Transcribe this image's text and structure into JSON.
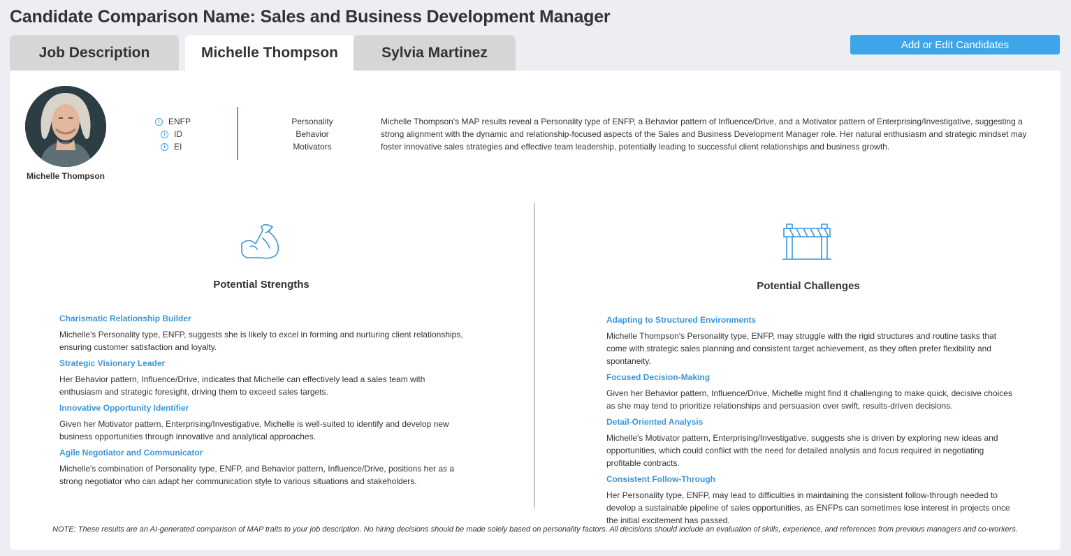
{
  "page": {
    "title": "Candidate Comparison Name: Sales and Business Development Manager"
  },
  "tabs": [
    {
      "label": "Job Description",
      "active": false
    },
    {
      "label": "Michelle Thompson",
      "active": true
    },
    {
      "label": "Sylvia Martinez",
      "active": false
    }
  ],
  "actions": {
    "add_edit_label": "Add or Edit Candidates"
  },
  "colors": {
    "accent": "#3ea5e8",
    "link": "#3a96d8",
    "background": "#eceef2",
    "tab_inactive": "#d6d6d6"
  },
  "candidate": {
    "name": "Michelle Thompson",
    "traits": [
      {
        "value": "ENFP",
        "category": "Personality",
        "icon": "info-icon"
      },
      {
        "value": "ID",
        "category": "Behavior",
        "icon": "info-icon"
      },
      {
        "value": "EI",
        "category": "Motivators",
        "icon": "info-icon"
      }
    ],
    "summary": "Michelle Thompson's MAP results reveal a Personality type of ENFP, a Behavior pattern of Influence/Drive, and a Motivator pattern of Enterprising/Investigative, suggesting a strong alignment with the dynamic and relationship-focused aspects of the Sales and Business Development Manager role. Her natural enthusiasm and strategic mindset may foster innovative sales strategies and effective team leadership, potentially leading to successful client relationships and business growth."
  },
  "strengths": {
    "title": "Potential Strengths",
    "icon": "flexed-arm-icon",
    "items": [
      {
        "title": "Charismatic Relationship Builder",
        "desc": "Michelle's Personality type, ENFP, suggests she is likely to excel in forming and nurturing client relationships, ensuring customer satisfaction and loyalty."
      },
      {
        "title": "Strategic Visionary Leader",
        "desc": "Her Behavior pattern, Influence/Drive, indicates that Michelle can effectively lead a sales team with enthusiasm and strategic foresight, driving them to exceed sales targets."
      },
      {
        "title": "Innovative Opportunity Identifier",
        "desc": "Given her Motivator pattern, Enterprising/Investigative, Michelle is well-suited to identify and develop new business opportunities through innovative and analytical approaches."
      },
      {
        "title": "Agile Negotiator and Communicator",
        "desc": "Michelle's combination of Personality type, ENFP, and Behavior pattern, Influence/Drive, positions her as a strong negotiator who can adapt her communication style to various situations and stakeholders."
      }
    ]
  },
  "challenges": {
    "title": "Potential Challenges",
    "icon": "barrier-icon",
    "items": [
      {
        "title": "Adapting to Structured Environments",
        "desc": "Michelle Thompson's Personality type, ENFP, may struggle with the rigid structures and routine tasks that come with strategic sales planning and consistent target achievement, as they often prefer flexibility and spontaneity."
      },
      {
        "title": "Focused Decision-Making",
        "desc": "Given her Behavior pattern, Influence/Drive, Michelle might find it challenging to make quick, decisive choices as she may tend to prioritize relationships and persuasion over swift, results-driven decisions."
      },
      {
        "title": "Detail-Oriented Analysis",
        "desc": "Michelle's Motivator pattern, Enterprising/Investigative, suggests she is driven by exploring new ideas and opportunities, which could conflict with the need for detailed analysis and focus required in negotiating profitable contracts."
      },
      {
        "title": "Consistent Follow-Through",
        "desc": "Her Personality type, ENFP, may lead to difficulties in maintaining the consistent follow-through needed to develop a sustainable pipeline of sales opportunities, as ENFPs can sometimes lose interest in projects once the initial excitement has passed."
      }
    ]
  },
  "note": "NOTE: These results are an AI-generated comparison of MAP traits to your job description. No hiring decisions should be made solely based on personality factors. All decisions should include an evaluation of skills, experience, and references from previous managers and co-workers."
}
